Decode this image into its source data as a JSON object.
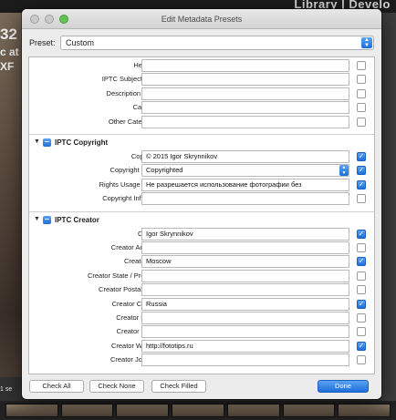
{
  "background": {
    "module_label": "Library | Develo",
    "left_fragments": [
      "32",
      "c at",
      "XF",
      "1 se"
    ]
  },
  "dialog": {
    "title": "Edit Metadata Presets",
    "preset_label": "Preset:",
    "preset_value": "Custom"
  },
  "basic_rows": [
    {
      "label": "Headline",
      "value": "",
      "checked": false
    },
    {
      "label": "IPTC Subject Code",
      "value": "",
      "checked": false
    },
    {
      "label": "Description Writer",
      "value": "",
      "checked": false
    },
    {
      "label": "Category",
      "value": "",
      "checked": false
    },
    {
      "label": "Other Categories",
      "value": "",
      "checked": false
    }
  ],
  "iptc_copyright": {
    "title": "IPTC Copyright",
    "rows": [
      {
        "label": "Copyright",
        "value": "© 2015 Igor Skrynnikov",
        "checked": true
      },
      {
        "label": "Copyright Status",
        "value": "Copyrighted",
        "checked": true
      },
      {
        "label": "Rights Usage Terms",
        "value": "Не разрешается использование фотографии без",
        "checked": true
      },
      {
        "label": "Copyright Info URL",
        "value": "",
        "checked": false
      }
    ]
  },
  "iptc_creator": {
    "title": "IPTC Creator",
    "rows": [
      {
        "label": "Creator",
        "value": "Igor Skrynnikov",
        "checked": true
      },
      {
        "label": "Creator Address",
        "value": "",
        "checked": false
      },
      {
        "label": "Creator City",
        "value": "Moscow",
        "checked": true
      },
      {
        "label": "Creator State / Province",
        "value": "",
        "checked": false
      },
      {
        "label": "Creator Postal Code",
        "value": "",
        "checked": false
      },
      {
        "label": "Creator Country",
        "value": "Russia",
        "checked": true
      },
      {
        "label": "Creator Phone",
        "value": "",
        "checked": false
      },
      {
        "label": "Creator E-Mail",
        "value": "",
        "checked": false
      },
      {
        "label": "Creator Website",
        "value": "http://fototips.ru",
        "checked": true
      },
      {
        "label": "Creator Job Title",
        "value": "",
        "checked": false
      }
    ]
  },
  "buttons": {
    "check_all": "Check All",
    "check_none": "Check None",
    "check_filled": "Check Filled",
    "done": "Done"
  },
  "colors": {
    "accent": "#1e6fdb",
    "dialog_bg": "#ececec"
  }
}
